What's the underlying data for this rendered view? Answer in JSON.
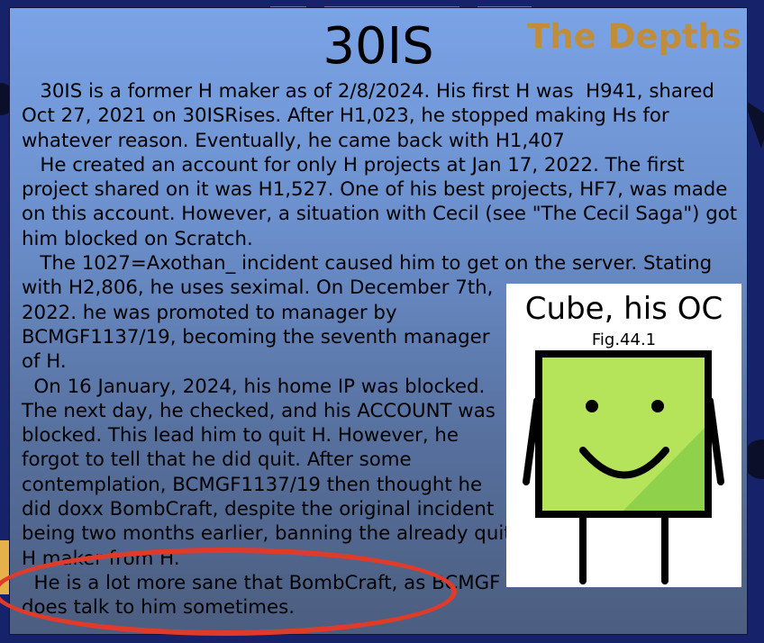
{
  "header": {
    "title": "30IS",
    "section": "The Depths"
  },
  "paragraphs": [
    "   30IS is a former H maker as of 2/8/2024. His first H was  H941, shared Oct 27, 2021 on 30ISRises. After H1,023, he stopped making Hs for whatever reason. Eventually, he came back with H1,407",
    "   He created an account for only H projects at Jan 17, 2022. The first project shared on it was H1,527. One of his best projects, HF7, was made on this account. However, a situation with Cecil (see \"The Cecil Saga\") got him blocked on Scratch.",
    "   The 1027=Axothan_ incident caused him to get on the server. Stating",
    "with H2,806, he uses seximal. On December 7th, 2022. he was promoted to manager by BCMGF1137/19, becoming the seventh manager of H.",
    "  On 16 January, 2024, his home IP was blocked. The next day, he checked, and his ACCOUNT was blocked. This lead him to quit H. However, he forgot to tell that he did quit. After some contemplation, BCMGF1137/19 then thought he did doxx BombCraft, despite the original incident being two months earlier, banning the already quit H maker from H.",
    "  He is a lot more sane that BombCraft, as BCMGF does talk to him sometimes."
  ],
  "figure": {
    "caption": "Cube, his OC",
    "number": "Fig.44.1",
    "colors": {
      "cube_fill": "#b5e35a",
      "cube_shade": "#8fd14a",
      "outline": "#000000"
    }
  },
  "colors": {
    "section_title": "#c08e3a",
    "highlight_circle": "#e03a2a"
  }
}
